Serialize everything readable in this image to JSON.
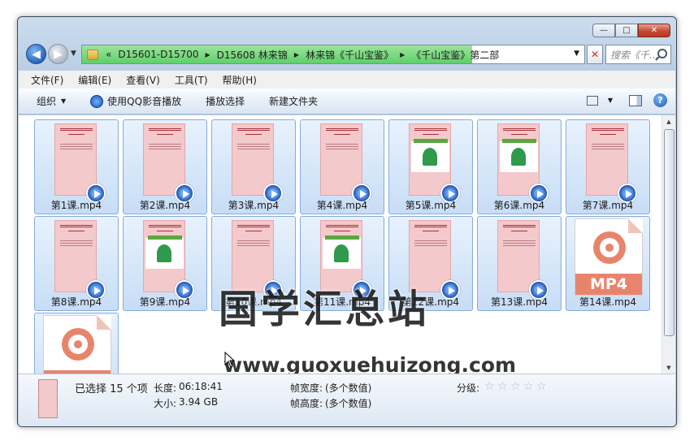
{
  "window": {
    "minimize": "—",
    "maximize": "□",
    "close": "✕"
  },
  "nav": {
    "breadcrumbs": [
      "D15601-D15700",
      "D15608 林来锦",
      "林来锦《千山宝鉴》",
      "《千山宝鉴》第二部"
    ],
    "overflow": "«",
    "search_placeholder": "搜索《千..."
  },
  "menu": [
    "文件(F)",
    "编辑(E)",
    "查看(V)",
    "工具(T)",
    "帮助(H)"
  ],
  "toolbar": {
    "organize": "组织",
    "play_qq": "使用QQ影音播放",
    "play_selection": "播放选择",
    "new_folder": "新建文件夹",
    "help": "?"
  },
  "files": [
    {
      "name": "第1课.mp4",
      "kind": "thumb"
    },
    {
      "name": "第2课.mp4",
      "kind": "thumb"
    },
    {
      "name": "第3课.mp4",
      "kind": "thumb"
    },
    {
      "name": "第4课.mp4",
      "kind": "thumb"
    },
    {
      "name": "第5课.mp4",
      "kind": "pic"
    },
    {
      "name": "第6课.mp4",
      "kind": "pic"
    },
    {
      "name": "第7课.mp4",
      "kind": "thumb"
    },
    {
      "name": "第8课.mp4",
      "kind": "thumb"
    },
    {
      "name": "第9课.mp4",
      "kind": "pic"
    },
    {
      "name": "第10课.mp4",
      "kind": "thumb"
    },
    {
      "name": "第11课.mp4",
      "kind": "pic"
    },
    {
      "name": "第12课.mp4",
      "kind": "thumb"
    },
    {
      "name": "第13课.mp4",
      "kind": "thumb"
    },
    {
      "name": "第14课.mp4",
      "kind": "mp4"
    },
    {
      "name": "",
      "kind": "mp4"
    }
  ],
  "mp4_label": "MP4",
  "watermark": {
    "cn": "国学汇总站",
    "url": "www.guoxuehuizong.com"
  },
  "details": {
    "selected": "已选择 15 个项",
    "length_label": "长度:",
    "length": "06:18:41",
    "size_label": "大小:",
    "size": "3.94 GB",
    "frame_width_label": "帧宽度:",
    "frame_width": "(多个数值)",
    "frame_height_label": "帧高度:",
    "frame_height": "(多个数值)",
    "rating_label": "分级:",
    "rating": 0,
    "rating_max": 5
  }
}
